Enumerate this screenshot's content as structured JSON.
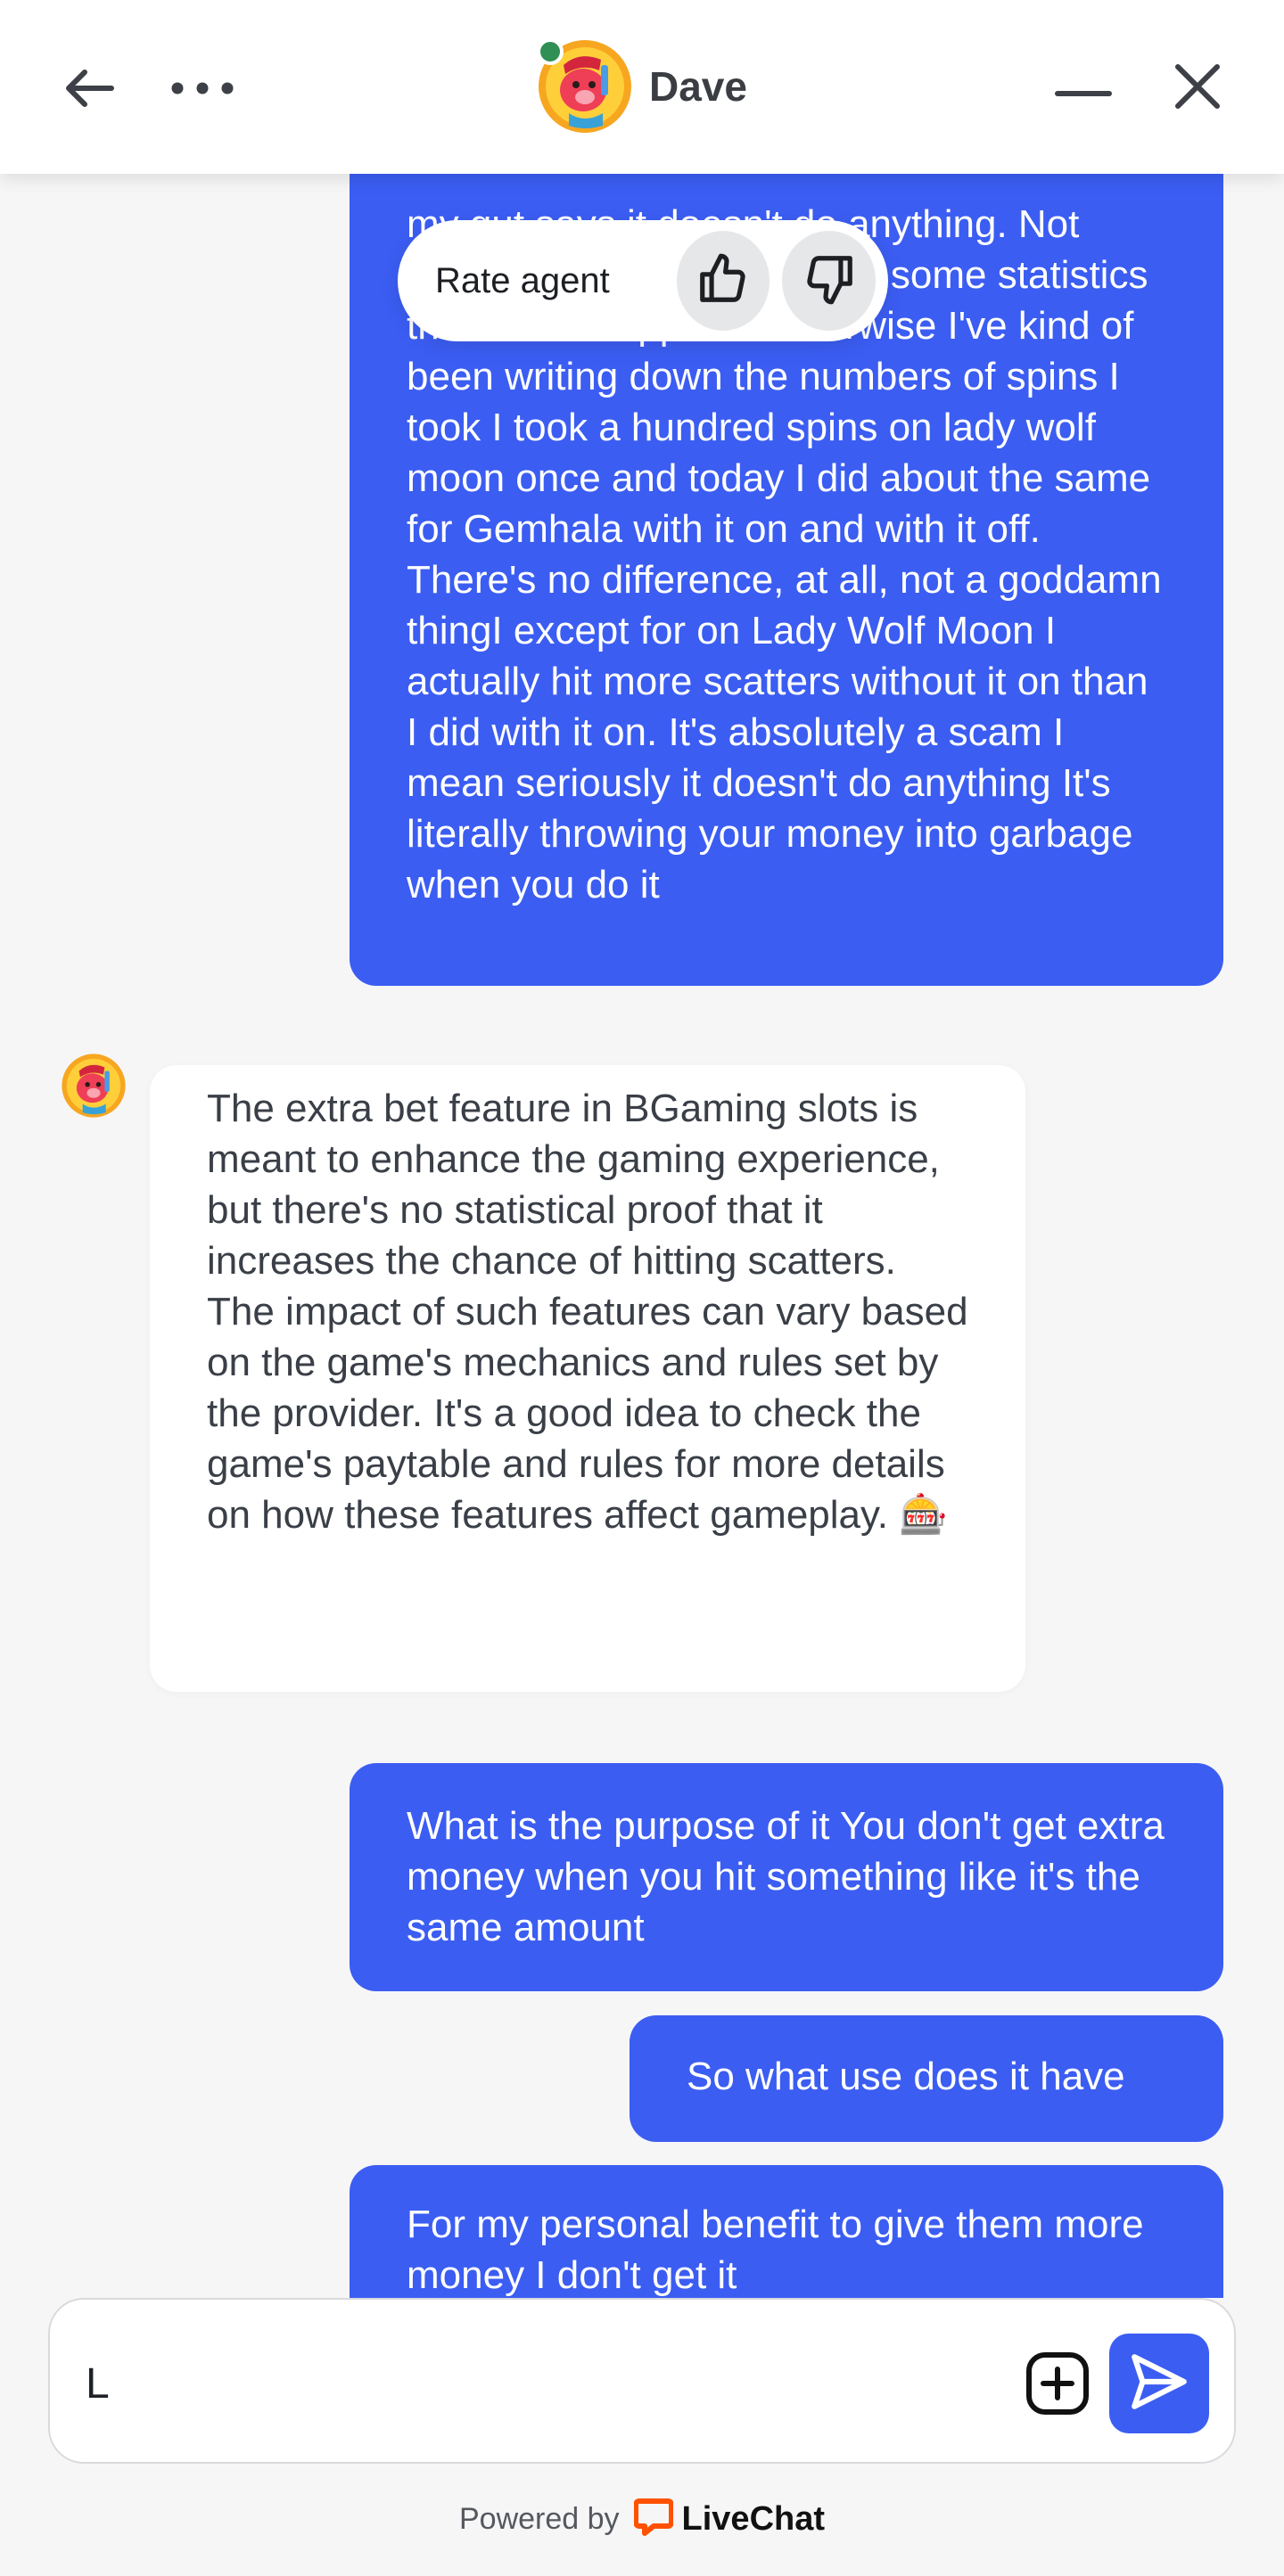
{
  "header": {
    "agent_name": "Dave",
    "status": "online",
    "colors": {
      "status_dot": "#2f8f55"
    }
  },
  "rate": {
    "label": "Rate agent"
  },
  "messages": [
    {
      "sender": "user",
      "text": "my gut says it doesn't do anything. Not sure of it I would like to see some statistics that would support it otherwise I've kind of been writing down the numbers of spins I took I took a hundred spins on lady wolf moon once and today I did about the same for Gemhala with it on and with it off. There's no difference, at all, not a goddamn thingI except for on Lady Wolf Moon I actually hit more scatters without it on than I did with it on. It's absolutely a scam I mean seriously it doesn't do anything It's literally throwing your money into garbage when you do it"
    },
    {
      "sender": "agent",
      "text": "The extra bet feature in BGaming slots is meant to enhance the gaming experience, but there's no statistical proof that it increases the chance of hitting scatters. The impact of such features can vary based on the game's mechanics and rules set by the provider. It's a good idea to check the game's paytable and rules for more details on how these features affect gameplay.",
      "emoji": "🎰"
    },
    {
      "sender": "user",
      "text": "What is the purpose of it You don't get extra money when you hit something like it's the same amount"
    },
    {
      "sender": "user",
      "text": "So what use does it have"
    },
    {
      "sender": "user",
      "text": "For my personal benefit to give them more money I don't get it"
    }
  ],
  "composer": {
    "value": "L"
  },
  "footer": {
    "powered_by": "Powered by",
    "brand": "LiveChat"
  },
  "colors": {
    "user_bubble": "#3b5df2",
    "agent_bubble": "#ffffff",
    "brand_orange": "#ff5100"
  }
}
